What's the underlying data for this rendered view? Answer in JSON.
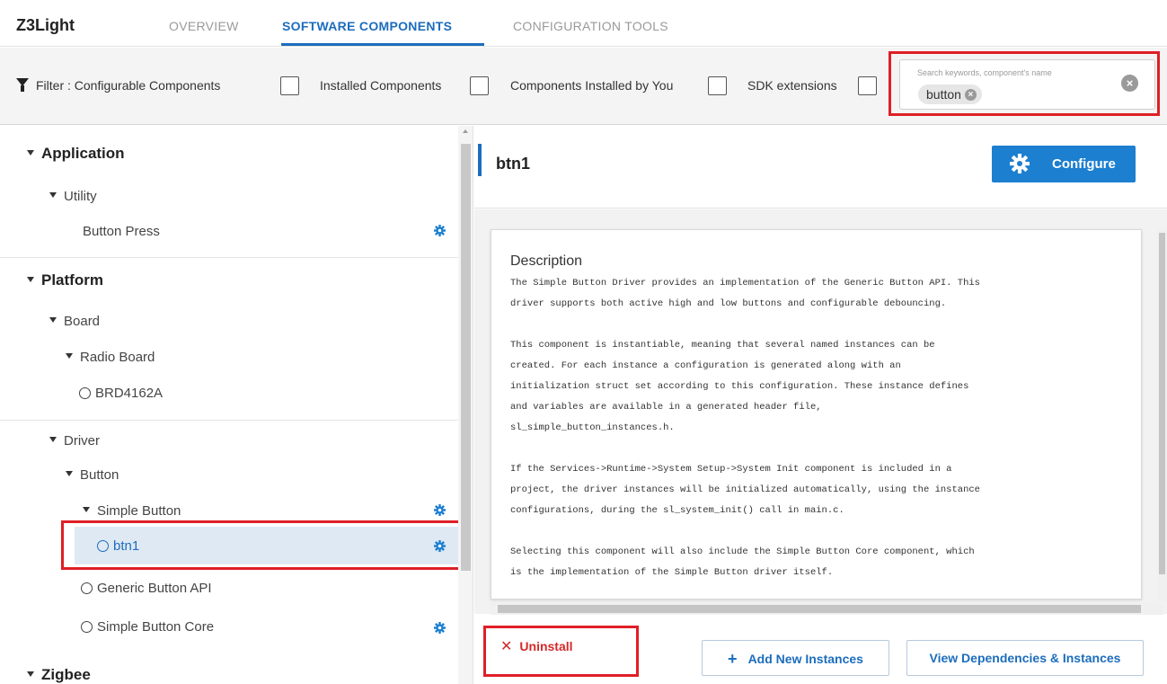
{
  "app": {
    "title": "Z3Light"
  },
  "tabs": [
    {
      "label": "OVERVIEW",
      "active": false
    },
    {
      "label": "SOFTWARE COMPONENTS",
      "active": true
    },
    {
      "label": "CONFIGURATION TOOLS",
      "active": false
    }
  ],
  "filter": {
    "label": "Filter : Configurable Components",
    "options": [
      {
        "label": "Installed Components",
        "checked": false
      },
      {
        "label": "Components Installed by You",
        "checked": false
      },
      {
        "label": "SDK extensions",
        "checked": false
      }
    ],
    "configurable_checked": false,
    "icon": "funnel-icon"
  },
  "search": {
    "placeholder": "Search keywords, component's name",
    "chip": "button"
  },
  "tree": {
    "application": "Application",
    "utility": "Utility",
    "button_press": "Button Press",
    "platform": "Platform",
    "board": "Board",
    "radio_board": "Radio Board",
    "brd": "BRD4162A",
    "driver": "Driver",
    "button": "Button",
    "simple_button": "Simple Button",
    "btn1": "btn1",
    "generic_api": "Generic Button API",
    "simple_core": "Simple Button Core",
    "zigbee": "Zigbee"
  },
  "detail": {
    "title": "btn1",
    "configure_label": "Configure",
    "description_heading": "Description",
    "description_lines": [
      "The Simple Button Driver provides an implementation of the Generic Button API. This",
      "driver supports both active high and low buttons and configurable debouncing.",
      "",
      "This component is instantiable, meaning that several named instances can be",
      "created. For each instance a configuration is generated along with an",
      "initialization struct set according to this configuration. These instance defines",
      "and variables are available in a generated header file,",
      "sl_simple_button_instances.h.",
      "",
      "If the Services->Runtime->System Setup->System Init component is included in a",
      "project, the driver instances will be initialized automatically, using the instance",
      "configurations, during the sl_system_init() call in main.c.",
      "",
      "Selecting this component will also include the Simple Button Core component, which",
      "is the implementation of the Simple Button driver itself."
    ]
  },
  "footer": {
    "uninstall": "Uninstall",
    "add_instances": "Add New Instances",
    "view_deps": "View Dependencies & Instances"
  },
  "colors": {
    "accent": "#1c6dbd",
    "highlight": "#e01e26",
    "selection": "#dfe9f3"
  }
}
